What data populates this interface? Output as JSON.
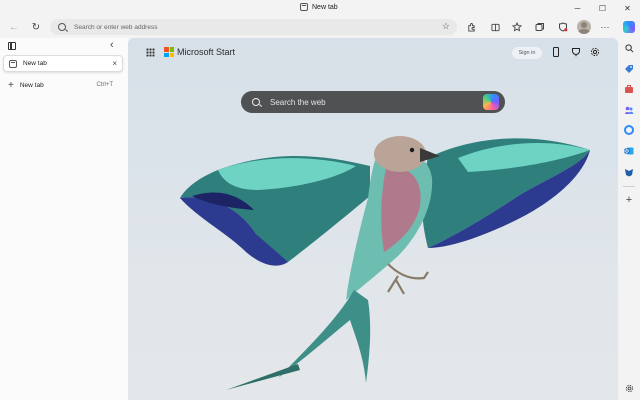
{
  "window": {
    "title": "New tab",
    "controls": {
      "minimize": "─",
      "maximize": "☐",
      "close": "✕"
    }
  },
  "toolbar": {
    "back": "←",
    "refresh": "↻",
    "address_placeholder": "Search or enter web address",
    "favorite_star": "☆"
  },
  "tabs_pane": {
    "active_tab": {
      "label": "New tab",
      "close": "×"
    },
    "new_tab": {
      "label": "New tab",
      "shortcut": "Ctrl+T"
    },
    "collapse": "‹"
  },
  "start_page": {
    "brand": "Microsoft Start",
    "signin": "Sign in",
    "search_placeholder": "Search the web"
  },
  "right_sidebar": {
    "items": [
      "search-icon",
      "tag-icon",
      "toolbox-icon",
      "people-icon",
      "office-icon",
      "outlook-icon",
      "games-icon",
      "add-icon",
      "settings-icon"
    ]
  },
  "colors": {
    "copilot_accent": "#2f8cff",
    "ms_red": "#f25022",
    "ms_green": "#7fba00",
    "ms_blue": "#00a4ef",
    "ms_yellow": "#ffb900"
  }
}
